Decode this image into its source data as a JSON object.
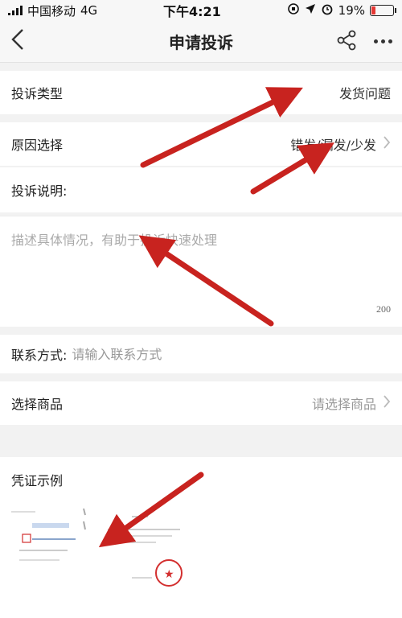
{
  "status": {
    "carrier": "中国移动",
    "network": "4G",
    "time": "下午4:21",
    "battery": "19%",
    "battery_level": 0.19
  },
  "nav": {
    "title": "申请投诉"
  },
  "form": {
    "type_label": "投诉类型",
    "type_value": "发货问题",
    "reason_label": "原因选择",
    "reason_value": "错发/漏发/少发",
    "desc_label": "投诉说明:",
    "desc_placeholder": "描述具体情况，有助于投诉快速处理",
    "desc_counter": "200",
    "contact_label": "联系方式:",
    "contact_placeholder": "请输入联系方式",
    "product_label": "选择商品",
    "product_placeholder": "请选择商品"
  },
  "voucher": {
    "title": "凭证示例"
  },
  "colors": {
    "arrow": "#c8231f",
    "stamp": "#d32f2f",
    "battery": "#e53935"
  }
}
